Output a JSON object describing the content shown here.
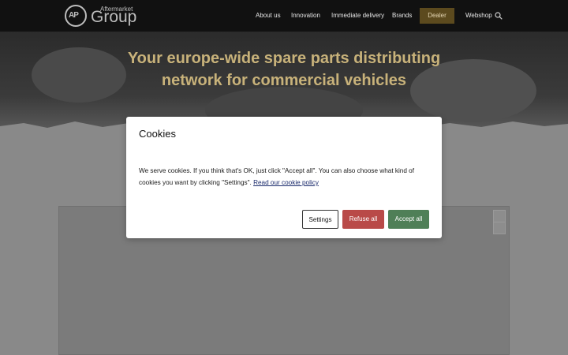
{
  "header": {
    "logo_sub": "Aftermarket",
    "logo_main": "Group",
    "logo_mark": "AP",
    "nav": [
      "About us",
      "Innovation",
      "Immediate delivery",
      "Brands"
    ],
    "dealer_label": "Dealer",
    "webshop_label": "Webshop"
  },
  "hero": {
    "title_line1": "Your europe-wide spare parts distributing",
    "title_line2": "network for commercial vehicles"
  },
  "cookie_modal": {
    "title": "Cookies",
    "text": "We serve cookies. If you think that's OK, just click \"Accept all\". You can also choose what kind of cookies you want by clicking \"Settings\".",
    "link": "Read our cookie policy",
    "settings_label": "Settings",
    "refuse_label": "Refuse all",
    "accept_label": "Accept all"
  },
  "colors": {
    "header_bg": "#111111",
    "dealer_bg": "#5c4a1e",
    "hero_title": "#c8b27a",
    "refuse_bg": "#b94a48",
    "accept_bg": "#4f7f57"
  },
  "icons": [
    "search-icon"
  ]
}
